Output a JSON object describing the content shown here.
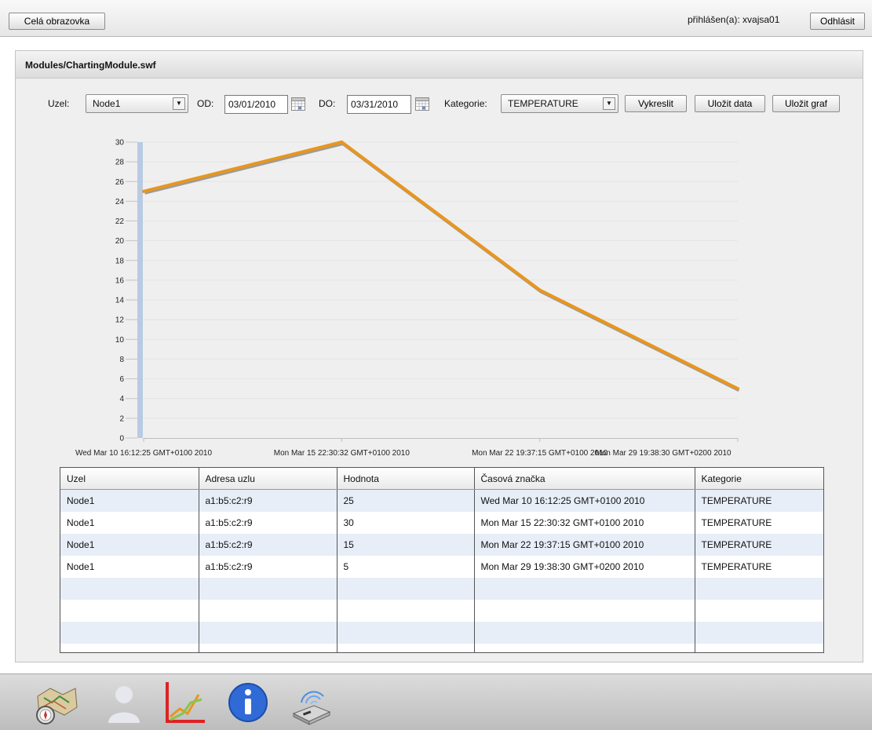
{
  "topbar": {
    "fullscreen_label": "Celá obrazovka",
    "logged_in_text": "přihlášen(a): xvajsa01",
    "logout_label": "Odhlásit"
  },
  "panel": {
    "title": "Modules/ChartingModule.swf"
  },
  "toolbar": {
    "node_label": "Uzel:",
    "node_value": "Node1",
    "from_label": "OD:",
    "from_value": "03/01/2010",
    "to_label": "DO:",
    "to_value": "03/31/2010",
    "category_label": "Kategorie:",
    "category_value": "TEMPERATURE",
    "draw_label": "Vykreslit",
    "save_data_label": "Uložit data",
    "save_chart_label": "Uložit graf"
  },
  "chart_data": {
    "type": "line",
    "x": [
      "Wed Mar 10 16:12:25 GMT+0100 2010",
      "Mon Mar 15 22:30:32 GMT+0100 2010",
      "Mon Mar 22 19:37:15 GMT+0100 2010",
      "Mon Mar 29 19:38:30 GMT+0200 2010"
    ],
    "series": [
      {
        "values": [
          25,
          30,
          15,
          5
        ],
        "color": "#e8961e"
      }
    ],
    "ylim": [
      0,
      30
    ],
    "yticks": [
      0,
      2,
      4,
      6,
      8,
      10,
      12,
      14,
      16,
      18,
      20,
      22,
      24,
      26,
      28,
      30
    ],
    "grid": true
  },
  "table": {
    "columns": [
      "Uzel",
      "Adresa uzlu",
      "Hodnota",
      "Časová značka",
      "Kategorie"
    ],
    "rows": [
      [
        "Node1",
        "a1:b5:c2:r9",
        "25",
        "Wed Mar 10 16:12:25 GMT+0100 2010",
        "TEMPERATURE"
      ],
      [
        "Node1",
        "a1:b5:c2:r9",
        "30",
        "Mon Mar 15 22:30:32 GMT+0100 2010",
        "TEMPERATURE"
      ],
      [
        "Node1",
        "a1:b5:c2:r9",
        "15",
        "Mon Mar 22 19:37:15 GMT+0100 2010",
        "TEMPERATURE"
      ],
      [
        "Node1",
        "a1:b5:c2:r9",
        "5",
        "Mon Mar 29 19:38:30 GMT+0200 2010",
        "TEMPERATURE"
      ]
    ]
  },
  "dock": {
    "icons": [
      "map-compass-icon",
      "user-icon",
      "chart-icon",
      "info-icon",
      "network-device-icon"
    ]
  }
}
